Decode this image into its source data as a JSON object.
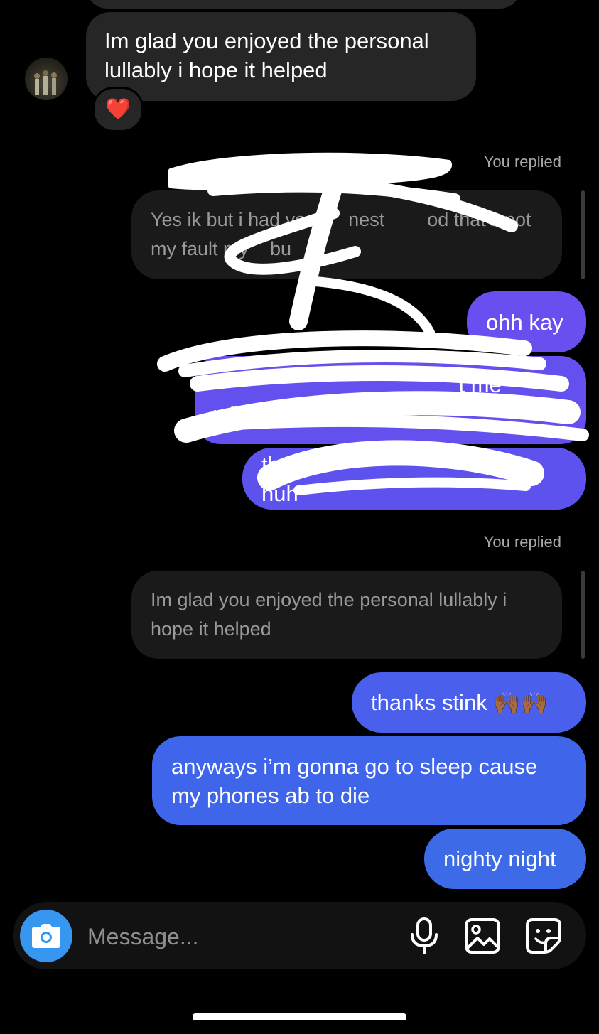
{
  "thread": {
    "top_incoming": {
      "text": "Im glad you enjoyed the personal\nlullably i hope it helped",
      "reaction": "❤️"
    },
    "reply_block_1": {
      "label": "You replied",
      "quoted_text": "Yes ik but i had yo        nest        od that's not\nmy fault my    bu"
    },
    "outgoing_mid": [
      {
        "text": "ohh kay"
      },
      {
        "text": "                                        t me\nwhen"
      },
      {
        "text": "th                                                huh"
      }
    ],
    "reply_block_2": {
      "label": "You replied",
      "quoted_text": "Im glad you enjoyed the personal lullably i\nhope it helped"
    },
    "outgoing_bottom": [
      {
        "text": "thanks stink 🙌🏾🙌🏾"
      },
      {
        "text": "anyways i’m gonna go to sleep cause\nmy phones ab to die"
      },
      {
        "text": "nighty night"
      }
    ]
  },
  "composer": {
    "placeholder": "Message...",
    "camera_icon": "camera-icon",
    "mic_icon": "microphone-icon",
    "gallery_icon": "gallery-icon",
    "sticker_icon": "sticker-icon"
  },
  "colors": {
    "background": "#000000",
    "incoming_bubble": "#262626",
    "quoted_bubble": "#1a1a1a",
    "outgoing_purple": "#6a4ff0",
    "outgoing_blue": "#3d6be8",
    "camera_button": "#3797f0"
  }
}
